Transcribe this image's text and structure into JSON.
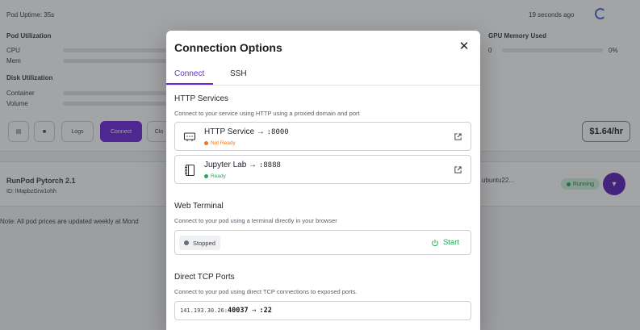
{
  "background": {
    "pod_uptime": "Pod Uptime: 35s",
    "updated_ago": "19 seconds ago",
    "pod_utilization": "Pod Utilization",
    "cpu": "CPU",
    "mem": "Mem",
    "disk_utilization": "Disk Utilization",
    "container": "Container",
    "volume": "Volume",
    "gpu_memory_used": "GPU Memory Used",
    "gpu_value": "0",
    "gpu_pct": "0%",
    "logs_button": "Logs",
    "connect_button": "Connect",
    "cloud_button": "Clo",
    "price": "$1.64/hr",
    "pod_name": "RunPod Pytorch 2.1",
    "pod_id": "ID: lMapbzGrw1ohh",
    "image_partial": "ubuntu22...",
    "running_badge": "Running",
    "note": "Note: All pod prices are updated weekly at Mond"
  },
  "modal": {
    "title": "Connection Options",
    "close_icon": "close-icon",
    "tabs": [
      {
        "label": "Connect",
        "active": true
      },
      {
        "label": "SSH",
        "active": false
      }
    ],
    "http": {
      "title": "HTTP Services",
      "description": "Connect to your service using HTTP using a proxied domain and port",
      "services": [
        {
          "name": "HTTP Service",
          "arrow": "→",
          "port": ":8000",
          "status": "Not Ready",
          "status_color": "#f97316",
          "icon": "server-icon"
        },
        {
          "name": "Jupyter Lab",
          "arrow": "→",
          "port": ":8888",
          "status": "Ready",
          "status_color": "#1fae54",
          "icon": "notebook-icon"
        }
      ]
    },
    "terminal": {
      "title": "Web Terminal",
      "description": "Connect to your pod using a terminal directly in your browser",
      "status": "Stopped",
      "start_label": "Start"
    },
    "tcp": {
      "title": "Direct TCP Ports",
      "description": "Connect to your pod using direct TCP connections to exposed ports.",
      "ip": "141.193.30.26:",
      "external_port": "40037",
      "arrow": "→",
      "internal_port": ":22"
    }
  },
  "colors": {
    "accent": "#6d28d9",
    "ready": "#1fae54",
    "not_ready": "#f97316"
  }
}
